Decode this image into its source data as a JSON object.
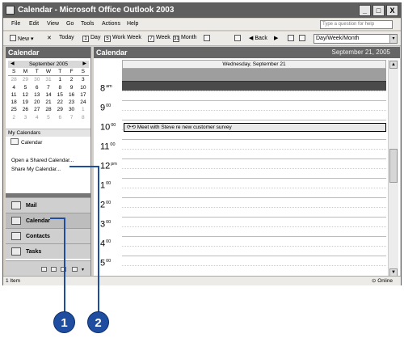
{
  "window": {
    "title": "Calendar - Microsoft Office Outlook 2003",
    "minimize": "_",
    "maximize": "□",
    "close": "X"
  },
  "menu": {
    "items": [
      "File",
      "Edit",
      "View",
      "Go",
      "Tools",
      "Actions",
      "Help"
    ],
    "help_placeholder": "Type a question for help"
  },
  "toolbar": {
    "new": "New",
    "today": "Today",
    "day": "Day",
    "work_week": "Work Week",
    "week": "Week",
    "month": "Month",
    "back": "Back",
    "view_select": "Day/Week/Month",
    "day_icon": "1",
    "work_week_icon": "5",
    "week_icon": "7",
    "month_icon": "31"
  },
  "nav": {
    "title": "Calendar",
    "mini_calendar": {
      "month": "September 2005",
      "weekdays": [
        "S",
        "M",
        "T",
        "W",
        "T",
        "F",
        "S"
      ],
      "weeks": [
        [
          "28",
          "29",
          "30",
          "31",
          "1",
          "2",
          "3"
        ],
        [
          "4",
          "5",
          "6",
          "7",
          "8",
          "9",
          "10"
        ],
        [
          "11",
          "12",
          "13",
          "14",
          "15",
          "16",
          "17"
        ],
        [
          "18",
          "19",
          "20",
          "21",
          "22",
          "23",
          "24"
        ],
        [
          "25",
          "26",
          "27",
          "28",
          "29",
          "30",
          "1"
        ],
        [
          "2",
          "3",
          "4",
          "5",
          "6",
          "7",
          "8"
        ]
      ]
    },
    "my_calendars": "My Calendars",
    "calendar_item": "Calendar",
    "open_shared": "Open a Shared Calendar...",
    "share_my": "Share My Calendar...",
    "buttons": {
      "mail": "Mail",
      "calendar": "Calendar",
      "contacts": "Contacts",
      "tasks": "Tasks"
    }
  },
  "main": {
    "title": "Calendar",
    "date": "September 21, 2005",
    "day_header": "Wednesday, September 21",
    "hours": [
      {
        "h": "8",
        "s": "am"
      },
      {
        "h": "9",
        "s": "00"
      },
      {
        "h": "10",
        "s": "00"
      },
      {
        "h": "11",
        "s": "00"
      },
      {
        "h": "12",
        "s": "pm"
      },
      {
        "h": "1",
        "s": "00"
      },
      {
        "h": "2",
        "s": "00"
      },
      {
        "h": "3",
        "s": "00"
      },
      {
        "h": "4",
        "s": "00"
      },
      {
        "h": "5",
        "s": "00"
      }
    ],
    "appointment": "Meet with Steve re new customer survey"
  },
  "status": {
    "items": "1 Item",
    "online": "Online"
  },
  "callouts": {
    "one": "1",
    "two": "2"
  }
}
